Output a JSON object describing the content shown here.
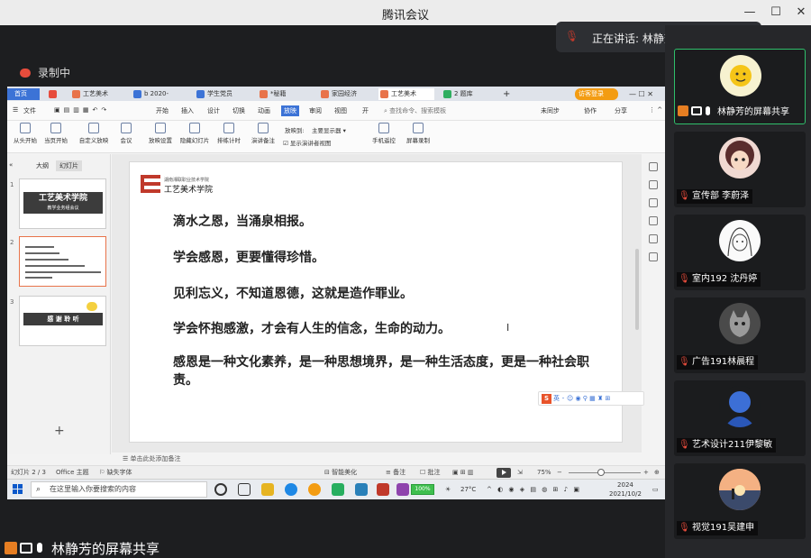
{
  "window": {
    "title": "腾讯会议"
  },
  "speaking": {
    "label": "正在讲话: 林静芳;"
  },
  "recording": {
    "label": "录制中"
  },
  "wps": {
    "tabs": [
      "首页",
      "",
      "工艺美术",
      "b 2020-",
      "学生党员",
      "*秘籍",
      "家园经济",
      "工艺美术",
      "2 题库"
    ],
    "tab_right_label": "访客登录",
    "menu_file": "文件",
    "menus": [
      "开始",
      "插入",
      "设计",
      "切换",
      "动画",
      "放映",
      "审阅",
      "视图",
      "开"
    ],
    "search_placeholder": "查找命令、搜索模板",
    "menu_right": [
      "未同步",
      "协作",
      "分享"
    ],
    "ribbon_buttons": [
      "从头开始",
      "当页开始",
      "自定义放映",
      "会议",
      "放映设置",
      "隐藏幻灯片",
      "排练计时",
      "演讲备注"
    ],
    "ribbon_screen_label": "放映到:",
    "ribbon_screen_value": "主要显示器",
    "ribbon_presenter_check": "显示演讲者视图",
    "ribbon_right_buttons": [
      "手机遥控",
      "屏幕录制"
    ],
    "left_tabs": [
      "大纲",
      "幻灯片"
    ],
    "thumbnails": {
      "t1_title": "工艺美术学院",
      "t1_sub": "教学业务组会议",
      "t3_title": "感 谢 聆 听"
    },
    "slide": {
      "school_small": "湖南湘联职业技术学院",
      "school_name": "工艺美术学院",
      "lines": [
        "滴水之恩，当涌泉相报。",
        "学会感恩，更要懂得珍惜。",
        "见利忘义，不知道恩德，这就是造作罪业。",
        "学会怀抱感激，才会有人生的信念，生命的动力。",
        "感恩是一种文化素养，是一种思想境界，是一种生活态度，更是一种社会职责。"
      ]
    },
    "ime_label": "英",
    "notes_placeholder": "单击此处添加备注",
    "status": {
      "slide_count": "幻灯片 2 / 3",
      "theme": "Office 主题",
      "font_missing": "缺失字体",
      "smart_beautify": "智能美化",
      "notes": "备注",
      "comments": "批注",
      "zoom": "75%"
    },
    "taskbar": {
      "search_placeholder": "在这里输入你要搜索的内容",
      "battery": "100%",
      "weather": "27°C",
      "time": "2024",
      "date": "2021/10/2"
    }
  },
  "share_label": "林静芳的屏幕共享",
  "participants": [
    {
      "name": "林静芳的屏幕共享",
      "avatar": "sun",
      "active": true
    },
    {
      "name": "宣传部 李蔚泽",
      "avatar": "anime-girl"
    },
    {
      "name": "室内192 沈丹婷",
      "avatar": "sketch-girl"
    },
    {
      "name": "广告191林晨程",
      "avatar": "cat"
    },
    {
      "name": "艺术设计211伊黎敏",
      "avatar": "blue-figure"
    },
    {
      "name": "视觉191吴建申",
      "avatar": "sunset"
    }
  ]
}
